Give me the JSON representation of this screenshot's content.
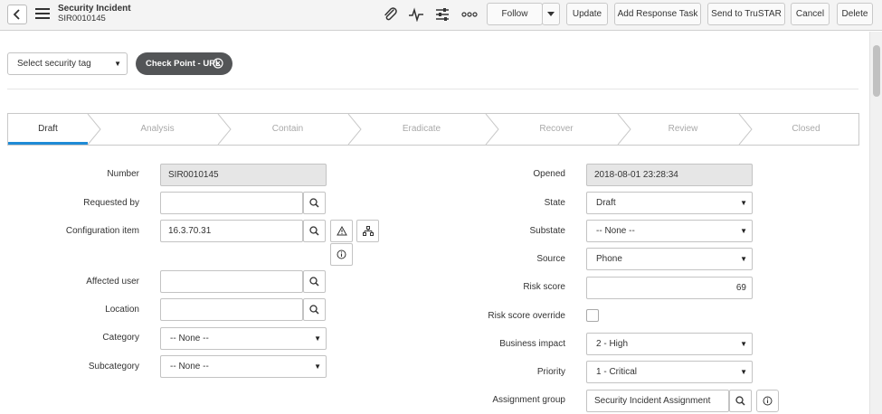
{
  "header": {
    "title": "Security Incident",
    "number": "SIR0010145",
    "icons": [
      "paperclip-icon",
      "activity-icon",
      "sliders-icon",
      "more-icon"
    ],
    "buttons": {
      "follow": "Follow",
      "update": "Update",
      "add_response_task": "Add Response Task",
      "send_to_trustar": "Send to TruSTAR",
      "cancel": "Cancel",
      "delete": "Delete"
    }
  },
  "tags": {
    "select_placeholder": "Select security tag",
    "applied_tag": "Check Point - URL"
  },
  "stages": [
    "Draft",
    "Analysis",
    "Contain",
    "Eradicate",
    "Recover",
    "Review",
    "Closed"
  ],
  "active_stage": "Draft",
  "form_left": {
    "number": {
      "label": "Number",
      "value": "SIR0010145"
    },
    "requested_by": {
      "label": "Requested by",
      "value": ""
    },
    "configuration_item": {
      "label": "Configuration item",
      "value": "16.3.70.31"
    },
    "affected_user": {
      "label": "Affected user",
      "value": ""
    },
    "location": {
      "label": "Location",
      "value": ""
    },
    "category": {
      "label": "Category",
      "value": "-- None --"
    },
    "subcategory": {
      "label": "Subcategory",
      "value": "-- None --"
    }
  },
  "form_right": {
    "opened": {
      "label": "Opened",
      "value": "2018-08-01 23:28:34"
    },
    "state": {
      "label": "State",
      "value": "Draft"
    },
    "substate": {
      "label": "Substate",
      "value": "-- None --"
    },
    "source": {
      "label": "Source",
      "value": "Phone"
    },
    "risk_score": {
      "label": "Risk score",
      "value": "69"
    },
    "risk_score_override": {
      "label": "Risk score override",
      "checked": false
    },
    "business_impact": {
      "label": "Business impact",
      "value": "2 - High"
    },
    "priority": {
      "label": "Priority",
      "value": "1 - Critical"
    },
    "assignment_group": {
      "label": "Assignment group",
      "value": "Security Incident Assignment"
    }
  },
  "colors": {
    "active_stage_underline": "#1f8bd6",
    "tag_pill": "#535557",
    "readonly_field": "#e6e6e6",
    "header_bg": "#f4f4f4"
  }
}
